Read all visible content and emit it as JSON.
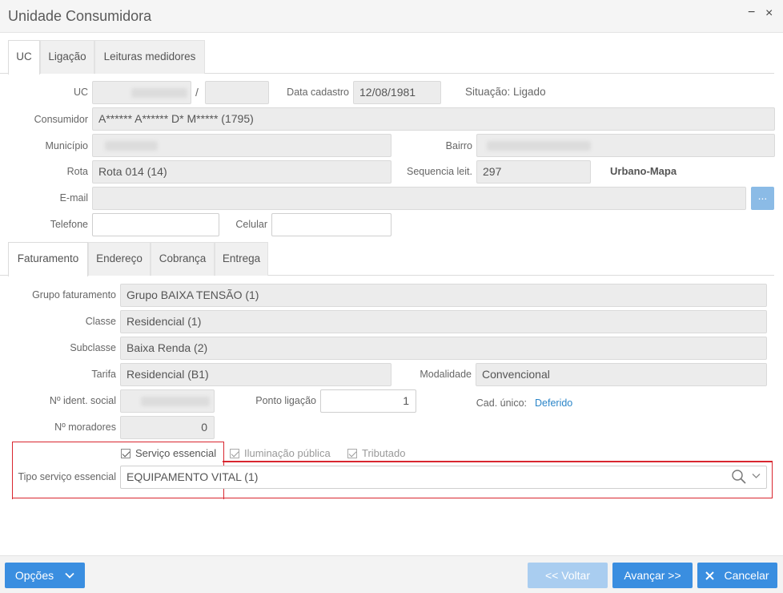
{
  "window": {
    "title": "Unidade Consumidora",
    "minimize_glyph": "−",
    "close_glyph": "×"
  },
  "top_tabs": [
    {
      "label": "UC",
      "active": true
    },
    {
      "label": "Ligação",
      "active": false
    },
    {
      "label": "Leituras medidores",
      "active": false
    }
  ],
  "uc": {
    "uc_label": "UC",
    "separator": "/",
    "data_cadastro_label": "Data cadastro",
    "data_cadastro_value": "12/08/1981",
    "situacao_text": "Situação: Ligado",
    "consumidor_label": "Consumidor",
    "consumidor_value": "A****** A****** D* M***** (1795)",
    "municipio_label": "Município",
    "bairro_label": "Bairro",
    "rota_label": "Rota",
    "rota_value": "Rota  014 (14)",
    "sequencia_label": "Sequencia leit.",
    "sequencia_value": "297",
    "zona_text": "Urbano-Mapa",
    "email_label": "E-mail",
    "email_button": "...",
    "telefone_label": "Telefone",
    "telefone_value": "",
    "celular_label": "Celular",
    "celular_value": ""
  },
  "sub_tabs": [
    {
      "label": "Faturamento",
      "active": true
    },
    {
      "label": "Endereço",
      "active": false
    },
    {
      "label": "Cobrança",
      "active": false
    },
    {
      "label": "Entrega",
      "active": false
    }
  ],
  "faturamento": {
    "grupo_label": "Grupo faturamento",
    "grupo_value": "Grupo BAIXA TENSÃO (1)",
    "classe_label": "Classe",
    "classe_value": "Residencial (1)",
    "subclasse_label": "Subclasse",
    "subclasse_value": "Baixa Renda (2)",
    "tarifa_label": "Tarifa",
    "tarifa_value": "Residencial (B1)",
    "modalidade_label": "Modalidade",
    "modalidade_value": "Convencional",
    "ident_social_label": "Nº ident. social",
    "ponto_ligacao_label": "Ponto ligação",
    "ponto_ligacao_value": "1",
    "cad_unico_label": "Cad. único:",
    "cad_unico_value": "Deferido",
    "moradores_label": "Nº moradores",
    "moradores_value": "0",
    "servico_essencial_label": "Serviço essencial",
    "iluminacao_publica_label": "Iluminação pública",
    "tributado_label": "Tributado",
    "tipo_servico_label": "Tipo serviço essencial",
    "tipo_servico_value": "EQUIPAMENTO VITAL (1)"
  },
  "footer": {
    "opcoes_label": "Opções",
    "voltar_label": "<< Voltar",
    "avancar_label": "Avançar >>",
    "cancelar_label": "Cancelar"
  },
  "colors": {
    "accent": "#3a8ee0",
    "accent_disabled": "#a9cdf0",
    "highlight": "#d9262f",
    "link": "#2a85c8"
  }
}
